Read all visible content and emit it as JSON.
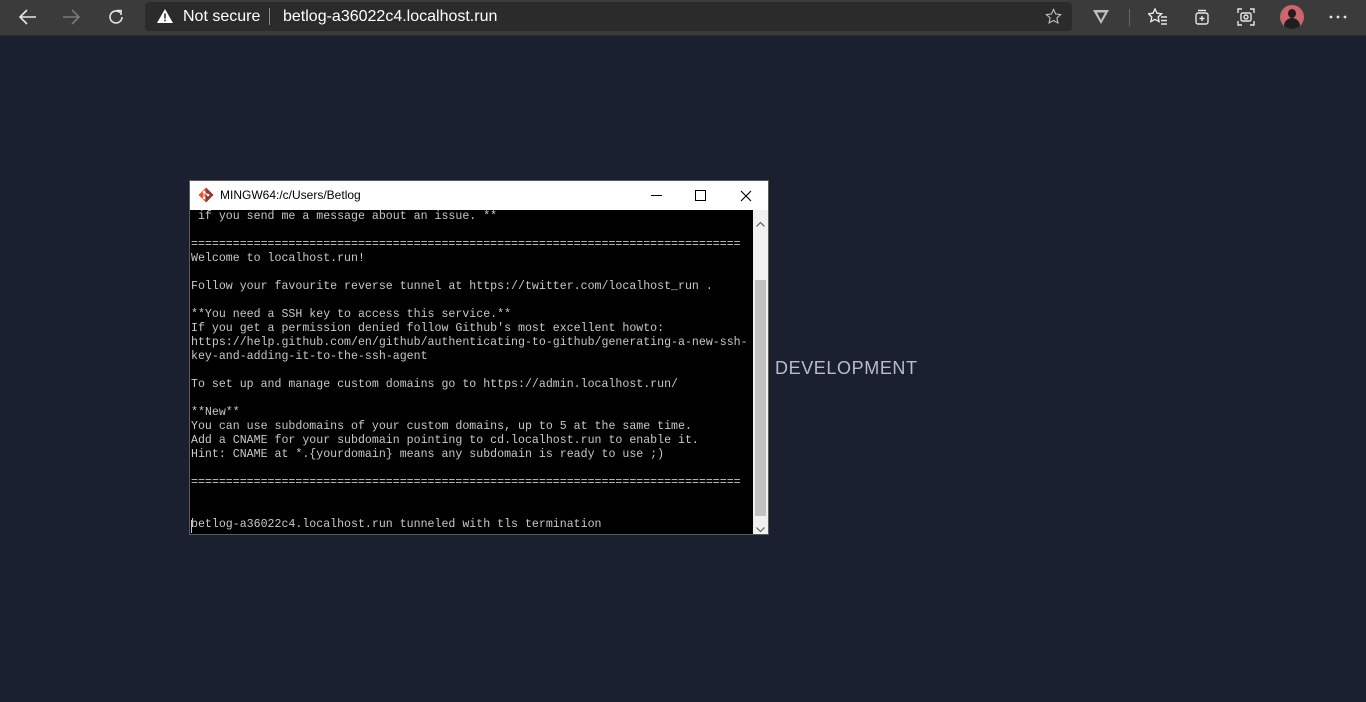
{
  "browser": {
    "security_label": "Not secure",
    "url": "betlog-a36022c4.localhost.run",
    "icons": [
      "back-icon",
      "forward-icon",
      "refresh-icon",
      "warning-icon",
      "star-icon",
      "vivaldi-icon",
      "favorites-icon",
      "collections-icon",
      "screenshot-icon",
      "profile-avatar",
      "more-icon"
    ]
  },
  "page": {
    "heading": "DEVELOPMENT",
    "background": "#1b2030"
  },
  "terminal": {
    "title": "MINGW64:/c/Users/Betlog",
    "lines": [
      " if you send me a message about an issue. **",
      "",
      "===============================================================================",
      "Welcome to localhost.run!",
      "",
      "Follow your favourite reverse tunnel at https://twitter.com/localhost_run .",
      "",
      "**You need a SSH key to access this service.**",
      "If you get a permission denied follow Github's most excellent howto:",
      "https://help.github.com/en/github/authenticating-to-github/generating-a-new-ssh-",
      "key-and-adding-it-to-the-ssh-agent",
      "",
      "To set up and manage custom domains go to https://admin.localhost.run/",
      "",
      "**New**",
      "You can use subdomains of your custom domains, up to 5 at the same time.",
      "Add a CNAME for your subdomain pointing to cd.localhost.run to enable it.",
      "Hint: CNAME at *.{yourdomain} means any subdomain is ready to use ;)",
      "",
      "===============================================================================",
      "",
      "",
      "betlog-a36022c4.localhost.run tunneled with tls termination"
    ]
  }
}
